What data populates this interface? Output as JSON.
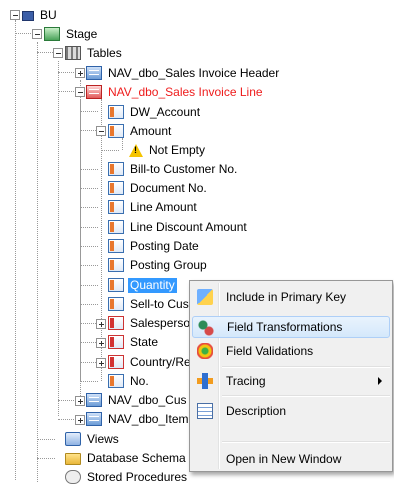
{
  "tree": {
    "root": {
      "label": "BU"
    },
    "stage": {
      "label": "Stage"
    },
    "tables": {
      "label": "Tables"
    },
    "items": [
      {
        "label": "NAV_dbo_Sales Invoice Header"
      },
      {
        "label": "NAV_dbo_Sales Invoice Line"
      },
      {
        "label": "DW_Account"
      },
      {
        "label": "Amount"
      },
      {
        "label": "Not Empty"
      },
      {
        "label": "Bill-to Customer No."
      },
      {
        "label": "Document No."
      },
      {
        "label": "Line Amount"
      },
      {
        "label": "Line Discount Amount"
      },
      {
        "label": "Posting Date"
      },
      {
        "label": "Posting Group"
      },
      {
        "label": "Quantity"
      },
      {
        "label": "Sell-to Cus"
      },
      {
        "label": "Salesperso"
      },
      {
        "label": "State"
      },
      {
        "label": "Country/Re"
      },
      {
        "label": "No."
      },
      {
        "label": "NAV_dbo_Cus"
      },
      {
        "label": "NAV_dbo_Item"
      }
    ],
    "views": {
      "label": "Views"
    },
    "schema": {
      "label": "Database Schema"
    },
    "procs": {
      "label": "Stored Procedures"
    }
  },
  "context_menu": {
    "items": [
      {
        "label": "Include in Primary Key",
        "icon": "primary-key-icon"
      },
      {
        "label": "Field Transformations",
        "icon": "transformations-icon"
      },
      {
        "label": "Field Validations",
        "icon": "validations-icon"
      },
      {
        "label": "Tracing",
        "icon": "tracing-icon"
      },
      {
        "label": "Description",
        "icon": "description-icon"
      },
      {
        "label": "Open in New Window"
      }
    ]
  },
  "colors": {
    "highlight": "#3399ff",
    "error_red": "#ee1c1c"
  }
}
